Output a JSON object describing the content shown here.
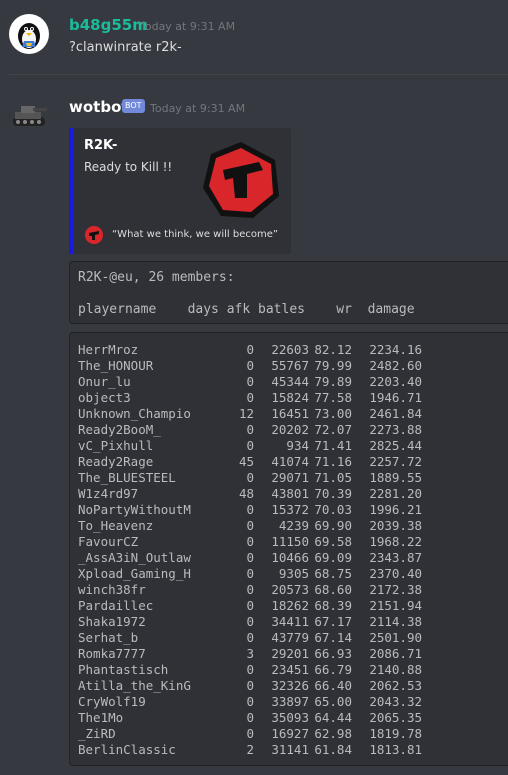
{
  "message1": {
    "username": "b48g55m",
    "timestamp": "Today at 9:31 AM",
    "text": "?clanwinrate r2k-"
  },
  "message2": {
    "username": "wotbot",
    "bot_tag": "BOT",
    "timestamp": "Today at 9:31 AM",
    "embed": {
      "title": "R2K-",
      "description": "Ready to Kill !!",
      "footer": "“What we think, we will become”"
    },
    "header_block": {
      "line1": "R2K-@eu, 26 members:",
      "line2": "playername    days afk batles    wr  damage"
    },
    "rows": [
      {
        "name": "HerrMroz",
        "afk": "0",
        "battles": "22603",
        "wr": "82.12",
        "damage": "2234.16"
      },
      {
        "name": "The_HONOUR",
        "afk": "0",
        "battles": "55767",
        "wr": "79.99",
        "damage": "2482.60"
      },
      {
        "name": "Onur_lu",
        "afk": "0",
        "battles": "45344",
        "wr": "79.89",
        "damage": "2203.40"
      },
      {
        "name": "object3",
        "afk": "0",
        "battles": "15824",
        "wr": "77.58",
        "damage": "1946.71"
      },
      {
        "name": "Unknown_Champio",
        "afk": "12",
        "battles": "16451",
        "wr": "73.00",
        "damage": "2461.84"
      },
      {
        "name": "Ready2BooM_",
        "afk": "0",
        "battles": "20202",
        "wr": "72.07",
        "damage": "2273.88"
      },
      {
        "name": "vC_Pixhull",
        "afk": "0",
        "battles": "934",
        "wr": "71.41",
        "damage": "2825.44"
      },
      {
        "name": "Ready2Rage",
        "afk": "45",
        "battles": "41074",
        "wr": "71.16",
        "damage": "2257.72"
      },
      {
        "name": "The_BLUESTEEL",
        "afk": "0",
        "battles": "29071",
        "wr": "71.05",
        "damage": "1889.55"
      },
      {
        "name": "W1z4rd97",
        "afk": "48",
        "battles": "43801",
        "wr": "70.39",
        "damage": "2281.20"
      },
      {
        "name": "NoPartyWithoutM",
        "afk": "0",
        "battles": "15372",
        "wr": "70.03",
        "damage": "1996.21"
      },
      {
        "name": "To_Heavenz",
        "afk": "0",
        "battles": "4239",
        "wr": "69.90",
        "damage": "2039.38"
      },
      {
        "name": "FavourCZ",
        "afk": "0",
        "battles": "11150",
        "wr": "69.58",
        "damage": "1968.22"
      },
      {
        "name": "_AssA3iN_Outlaw",
        "afk": "0",
        "battles": "10466",
        "wr": "69.09",
        "damage": "2343.87"
      },
      {
        "name": "Xpload_Gaming_H",
        "afk": "0",
        "battles": "9305",
        "wr": "68.75",
        "damage": "2370.40"
      },
      {
        "name": "winch38fr",
        "afk": "0",
        "battles": "20573",
        "wr": "68.60",
        "damage": "2172.38"
      },
      {
        "name": "Pardaillec",
        "afk": "0",
        "battles": "18262",
        "wr": "68.39",
        "damage": "2151.94"
      },
      {
        "name": "Shaka1972",
        "afk": "0",
        "battles": "34411",
        "wr": "67.17",
        "damage": "2114.38"
      },
      {
        "name": "Serhat_b",
        "afk": "0",
        "battles": "43779",
        "wr": "67.14",
        "damage": "2501.90"
      },
      {
        "name": "Romka7777",
        "afk": "3",
        "battles": "29201",
        "wr": "66.93",
        "damage": "2086.71"
      },
      {
        "name": "Phantastisch",
        "afk": "0",
        "battles": "23451",
        "wr": "66.79",
        "damage": "2140.88"
      },
      {
        "name": "Atilla_the_KinG",
        "afk": "0",
        "battles": "32326",
        "wr": "66.40",
        "damage": "2062.53"
      },
      {
        "name": "CryWolf19",
        "afk": "0",
        "battles": "33897",
        "wr": "65.00",
        "damage": "2043.32"
      },
      {
        "name": "The1Mo",
        "afk": "0",
        "battles": "35093",
        "wr": "64.44",
        "damage": "2065.35"
      },
      {
        "name": "_ZiRD",
        "afk": "0",
        "battles": "16927",
        "wr": "62.98",
        "damage": "1819.78"
      },
      {
        "name": "BerlinClassic",
        "afk": "2",
        "battles": "31141",
        "wr": "61.84",
        "damage": "1813.81"
      }
    ]
  },
  "colors": {
    "background": "#36393f",
    "username1": "#1abc9c",
    "username2": "#ffffff",
    "bot_tag": "#7289da",
    "embed_border": "#1a1adb"
  },
  "icons": {
    "avatar1": "penguin-avatar-icon",
    "avatar2": "tank-avatar-icon",
    "embed_thumb": "clan-logo-icon"
  }
}
